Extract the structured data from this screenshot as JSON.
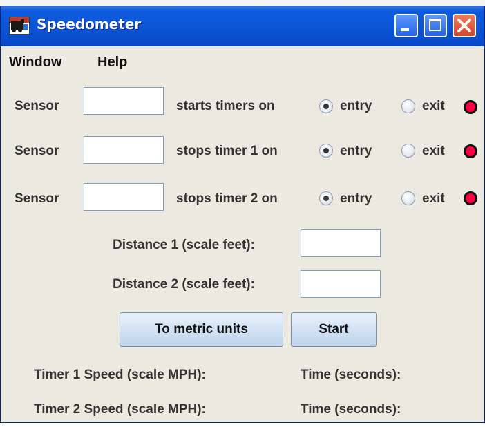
{
  "window": {
    "title": "Speedometer"
  },
  "menu": [
    "Window",
    "Help"
  ],
  "sensors": [
    {
      "label": "Sensor",
      "action": "starts timers on",
      "value": "",
      "entry": "entry",
      "exit": "exit",
      "selected": "entry"
    },
    {
      "label": "Sensor",
      "action": "stops timer 1 on",
      "value": "",
      "entry": "entry",
      "exit": "exit",
      "selected": "entry"
    },
    {
      "label": "Sensor",
      "action": "stops timer 2 on",
      "value": "",
      "entry": "entry",
      "exit": "exit",
      "selected": "entry"
    }
  ],
  "distances": [
    {
      "label": "Distance 1 (scale feet):",
      "value": ""
    },
    {
      "label": "Distance 2 (scale feet):",
      "value": ""
    }
  ],
  "buttons": {
    "metric": "To metric units",
    "start": "Start"
  },
  "results": [
    {
      "speed_label": "Timer 1 Speed (scale MPH):",
      "time_label": "Time (seconds):"
    },
    {
      "speed_label": "Timer 2 Speed (scale MPH):",
      "time_label": "Time (seconds):"
    }
  ],
  "colors": {
    "titlebar": "#0a55d6",
    "window_bg": "#ece9e0",
    "indicator": "#ff0040"
  },
  "icons": [
    "app-icon",
    "minimize-icon",
    "maximize-icon",
    "close-icon",
    "sensor-indicator-icon"
  ]
}
